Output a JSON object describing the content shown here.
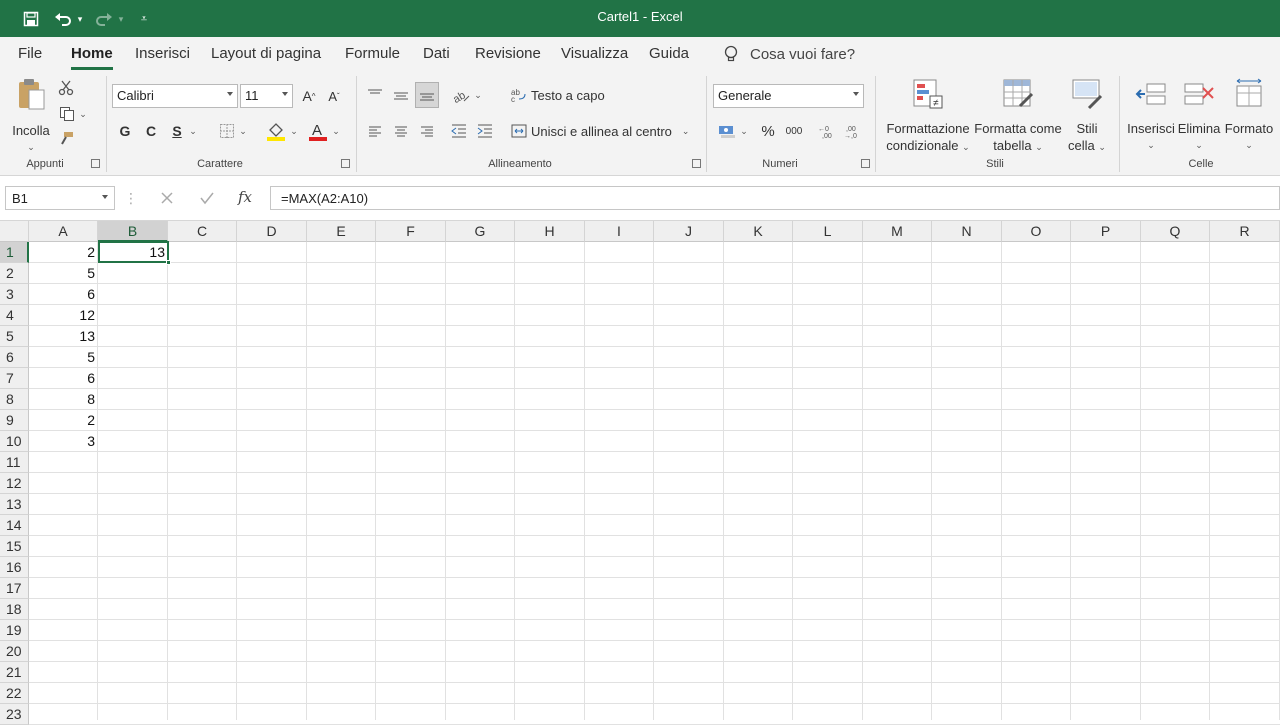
{
  "window": {
    "title": "Cartel1  -  Excel"
  },
  "tabs": [
    "File",
    "Home",
    "Inserisci",
    "Layout di pagina",
    "Formule",
    "Dati",
    "Revisione",
    "Visualizza",
    "Guida"
  ],
  "tell_me": "Cosa vuoi fare?",
  "ribbon": {
    "clipboard": {
      "paste_label": "Incolla",
      "group": "Appunti"
    },
    "font": {
      "name": "Calibri",
      "size": "11",
      "bold": "G",
      "italic": "C",
      "underline": "S",
      "grow": "A",
      "shrink": "A",
      "group": "Carattere",
      "font_color": "#e02020",
      "highlight_color": "#ffe600"
    },
    "alignment": {
      "wrap": "Testo a capo",
      "merge": "Unisci e allinea al centro",
      "group": "Allineamento"
    },
    "number": {
      "format": "Generale",
      "percent": "%",
      "thousands": "000",
      "group": "Numeri"
    },
    "styles": {
      "conditional_l1": "Formattazione",
      "conditional_l2": "condizionale",
      "table_l1": "Formatta come",
      "table_l2": "tabella",
      "cell_l1": "Stili",
      "cell_l2": "cella",
      "group": "Stili"
    },
    "cells": {
      "insert": "Inserisci",
      "delete": "Elimina",
      "format": "Formato",
      "group": "Celle"
    }
  },
  "formula_bar": {
    "name_box": "B1",
    "fx": "fx",
    "formula": "=MAX(A2:A10)"
  },
  "sheet": {
    "columns": [
      "A",
      "B",
      "C",
      "D",
      "E",
      "F",
      "G",
      "H",
      "I",
      "J",
      "K",
      "L",
      "M",
      "N",
      "O",
      "P",
      "Q",
      "R"
    ],
    "rows": [
      "1",
      "2",
      "3",
      "4",
      "5",
      "6",
      "7",
      "8",
      "9",
      "10",
      "11",
      "12",
      "13",
      "14",
      "15",
      "16",
      "17",
      "18",
      "19",
      "20",
      "21",
      "22",
      "23"
    ],
    "selected_cell": "B1",
    "column_a": [
      "2",
      "5",
      "6",
      "12",
      "13",
      "5",
      "6",
      "8",
      "2",
      "3"
    ],
    "b1": "13"
  },
  "colors": {
    "accent": "#217346"
  }
}
